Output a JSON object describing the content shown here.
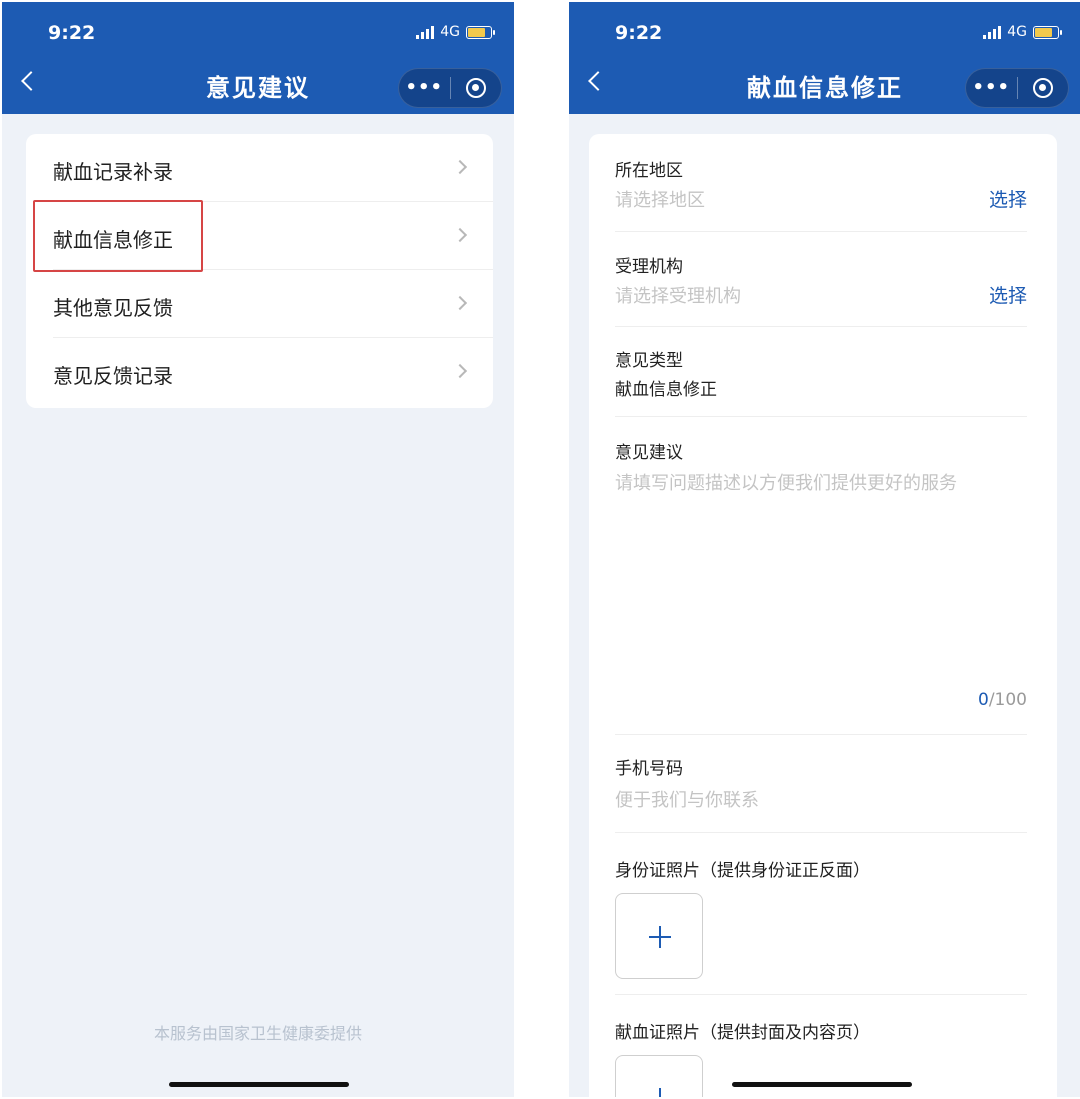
{
  "left": {
    "status": {
      "time": "9:22",
      "network": "4G"
    },
    "nav": {
      "title": "意见建议",
      "more_label": "•••"
    },
    "menu": [
      {
        "label": "献血记录补录"
      },
      {
        "label": "献血信息修正",
        "highlighted": true
      },
      {
        "label": "其他意见反馈"
      },
      {
        "label": "意见反馈记录"
      }
    ],
    "footer_note": "本服务由国家卫生健康委提供"
  },
  "right": {
    "status": {
      "time": "9:22",
      "network": "4G"
    },
    "nav": {
      "title": "献血信息修正",
      "more_label": "•••"
    },
    "form": {
      "region": {
        "label": "所在地区",
        "placeholder": "请选择地区",
        "action": "选择"
      },
      "agency": {
        "label": "受理机构",
        "placeholder": "请选择受理机构",
        "action": "选择"
      },
      "type": {
        "label": "意见类型",
        "value": "献血信息修正"
      },
      "suggestion": {
        "label": "意见建议",
        "placeholder": "请填写问题描述以方便我们提供更好的服务",
        "count_current": "0",
        "count_max": "/100"
      },
      "phone": {
        "label": "手机号码",
        "placeholder": "便于我们与你联系"
      },
      "id_photo": {
        "label": "身份证照片（提供身份证正反面）"
      },
      "donation_photo": {
        "label": "献血证照片（提供封面及内容页）"
      }
    }
  },
  "colors": {
    "header": "#1d5bb3",
    "accent": "#1d5bb3",
    "highlight": "#d64545",
    "page_bg": "#eef2f8"
  },
  "icons": [
    "back-icon",
    "more-icon",
    "close-target-icon",
    "signal-icon",
    "battery-icon",
    "chevron-right-icon",
    "plus-icon"
  ]
}
